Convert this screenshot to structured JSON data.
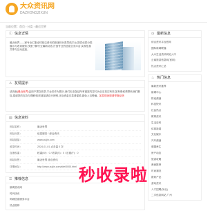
{
  "header": {
    "logo_text": "大众资讯网",
    "logo_sub": "DAZHONGZIXUN"
  },
  "breadcrumb": "当前位置：首页 › 分类 › 最近世界",
  "intro": {
    "title": "信息详情",
    "text": "最近世界——家专业汇集全球前沿资讯的新媒体分类导航平台,提供优质分类展示与收录服务,快速了解行业最新动态,打造专业的信息交流平台,实现信息共享与互动连接。"
  },
  "warning": {
    "title": "友情提示",
    "text_prefix": "该页面",
    "text_highlight": "(最近世界)",
    "text_main": "由用户提交收录,平台仅作为展示,我们无法保证所有链接内容均为合法真实有效,如有侵权请联系我们删除,感谢您的支持与理解!相关链接请自行辨别,涉及资金交易请谨慎,避免上当受骗。",
    "text_tail": "如发现违规请举报反馈"
  },
  "info": {
    "title": "信息资料",
    "rows": [
      {
        "k": "网站名称：",
        "v": "最近世界"
      },
      {
        "k": "网站分类：",
        "v": "信息服务 / 综合资讯"
      },
      {
        "k": "网站链接：",
        "v": "www.zuijin.com"
      },
      {
        "k": "收录时间：",
        "v": "2024-01-01 点击量 0 次"
      },
      {
        "k": "百度权重：",
        "v": "权重(W)：0 / 收录(S)：0 / 反链(F)：0"
      },
      {
        "k": "网站标签：",
        "v": "最近世界 综合资讯"
      },
      {
        "k": "详情地址：",
        "v": "http://www.zuijin.com/site/0000.html"
      }
    ]
  },
  "related": {
    "title": "推荐信息",
    "items": [
      "新闻资讯网",
      "时代快讯",
      "同城信息服务平台",
      "热点推荐"
    ]
  },
  "sidebar": {
    "latest": {
      "title": "最新信息",
      "items": [
        "综合资讯平台官网",
        "国际新闻联播",
        "大众生活资讯网站入口",
        "云南旅游信息网(官网)",
        "热点资讯汇总"
      ]
    },
    "hot": {
      "title": "热门信息",
      "items": [
        "最新资讯推荐",
        "新闻中心",
        "财经频道",
        "科技快讯",
        "社会热点",
        "教育资讯",
        "生活百科",
        "体育新闻",
        "文化娱乐",
        "汽车频道",
        "健康养生",
        "房产动态",
        "旅游攻略",
        "美食推荐",
        "时尚潮流",
        "数码产品",
        "游戏资讯",
        "人才招聘(河北)",
        "二手信息网站 广州"
      ]
    }
  },
  "watermark": "秒收录啦"
}
